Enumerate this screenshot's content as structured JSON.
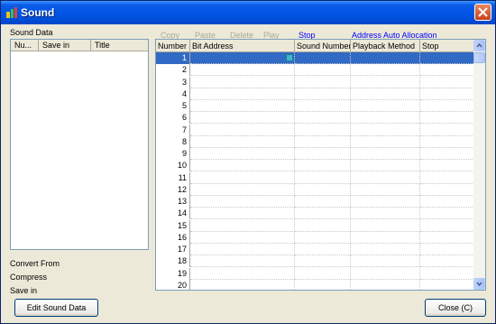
{
  "window": {
    "title": "Sound"
  },
  "left": {
    "section_label": "Sound Data",
    "columns": [
      "Nu...",
      "Save in",
      "Title"
    ],
    "info_labels": [
      "Convert From",
      "Compress",
      "Save in"
    ],
    "edit_button": "Edit Sound Data"
  },
  "toolbar": {
    "copy": "Copy",
    "paste": "Paste",
    "delete": "Delete",
    "play": "Play",
    "stop": "Stop",
    "auto_alloc": "Address Auto Allocation"
  },
  "grid": {
    "columns": [
      "Number",
      "Bit Address",
      "Sound Number",
      "Playback Method",
      "Stop"
    ],
    "rows": [
      "1",
      "2",
      "3",
      "4",
      "5",
      "6",
      "7",
      "8",
      "9",
      "10",
      "11",
      "12",
      "13",
      "14",
      "15",
      "16",
      "17",
      "18",
      "19",
      "20"
    ],
    "selected_row": "1"
  },
  "footer": {
    "close_button": "Close (C)"
  },
  "colors": {
    "titlebar": "#0054e3",
    "selection": "#316ac5",
    "link": "#0000ff"
  }
}
